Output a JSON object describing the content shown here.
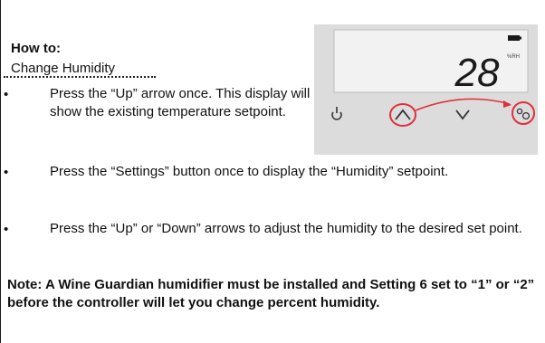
{
  "section": {
    "label": "How to:",
    "task": "Change Humidity"
  },
  "bullets": [
    {
      "marker": "•",
      "text": "Press the “Up” arrow once. This display will show the existing temperature setpoint."
    },
    {
      "marker": "•",
      "text": "Press the “Settings” button once to display the “Humidity” setpoint."
    },
    {
      "marker": "•",
      "text": "Press the “Up” or “Down” arrows to adjust the humidity to the desired set point."
    }
  ],
  "note": "Note: A Wine Guardian humidifier must be installed and Setting 6 set to “1” or “2” before the controller will let you change percent humidity.",
  "display": {
    "value": "28",
    "unit": "%RH"
  },
  "colors": {
    "highlight_circle": "#e0303a",
    "panel_bg": "#dcdcdc",
    "screen_bg": "#f2f2f2"
  },
  "icons": [
    "power-icon",
    "up-arrow-icon",
    "down-arrow-icon",
    "settings-icon"
  ]
}
